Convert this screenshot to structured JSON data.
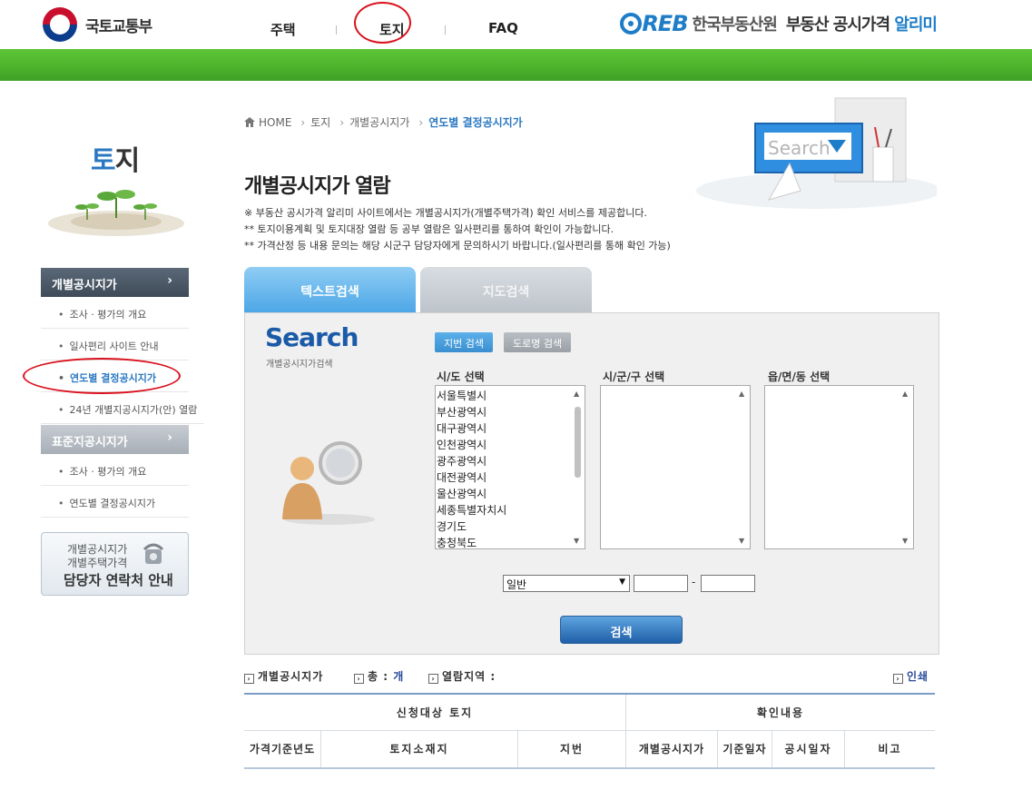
{
  "header": {
    "ministry_name": "국토교통부",
    "nav": [
      "주택",
      "토지",
      "FAQ"
    ],
    "reb_mark": "REB",
    "reb_name": "한국부동산원",
    "site_title_prefix": "부동산 공시가격",
    "site_title_brand": "알리미"
  },
  "sidebar": {
    "title_blue": "토",
    "title_rest": "지",
    "sections": [
      {
        "label": "개별공시지가",
        "arrow": "›",
        "items": [
          "조사 · 평가의 개요",
          "일사편리 사이트 안내",
          "연도별 결정공시지가",
          "24년 개별지공시지가(안) 열람"
        ]
      },
      {
        "label": "표준지공시지가",
        "arrow": "›",
        "items": [
          "조사 · 평가의 개요",
          "연도별 결정공시지가"
        ]
      }
    ],
    "contact": {
      "line1": "개별공시지가",
      "line2": "개별주택가격",
      "line3": "담당자 연락처 안내"
    }
  },
  "breadcrumb": {
    "home": "HOME",
    "items": [
      "토지",
      "개별공시지가"
    ],
    "current": "연도별 결정공시지가"
  },
  "page_title": "개별공시지가 열람",
  "notes": [
    "※ 부동산 공시가격 알리미 사이트에서는 개별공시지가(개별주택가격) 확인 서비스를 제공합니다.",
    "** 토지이용계획 및 토지대장 열람 등 공부 열람은 일사편리를 통하여 확인이 가능합니다.",
    "** 가격산정 등 내용 문의는 해당 시군구 담당자에게 문의하시기 바랍니다.(일사편리를 통해 확인 가능)"
  ],
  "tabs": {
    "text_search": "텍스트검색",
    "map_search": "지도검색"
  },
  "search": {
    "heading": "Search",
    "subheading": "개별공시지가검색",
    "mode_lot": "지번 검색",
    "mode_road": "도로명 검색",
    "sido_label": "시/도 선택",
    "sigungu_label": "시/군/구 선택",
    "eupmyeon_label": "읍/면/동 선택",
    "sido_options": [
      "서울특별시",
      "부산광역시",
      "대구광역시",
      "인천광역시",
      "광주광역시",
      "대전광역시",
      "울산광역시",
      "세종특별자치시",
      "경기도",
      "충청북도"
    ],
    "type_select": "일반",
    "dash": "-",
    "submit": "검색",
    "banner_search_text": "Search"
  },
  "results": {
    "label_price": "개별공시지가",
    "label_total": "총 :",
    "total_unit": "개",
    "label_region": "열람지역 :",
    "print": "인쇄"
  },
  "table": {
    "group_left": "신청대상 토지",
    "group_right": "확인내용",
    "columns": [
      "가격기준년도",
      "토지소재지",
      "지번",
      "개별공시지가",
      "기준일자",
      "공시일자",
      "비고"
    ]
  }
}
